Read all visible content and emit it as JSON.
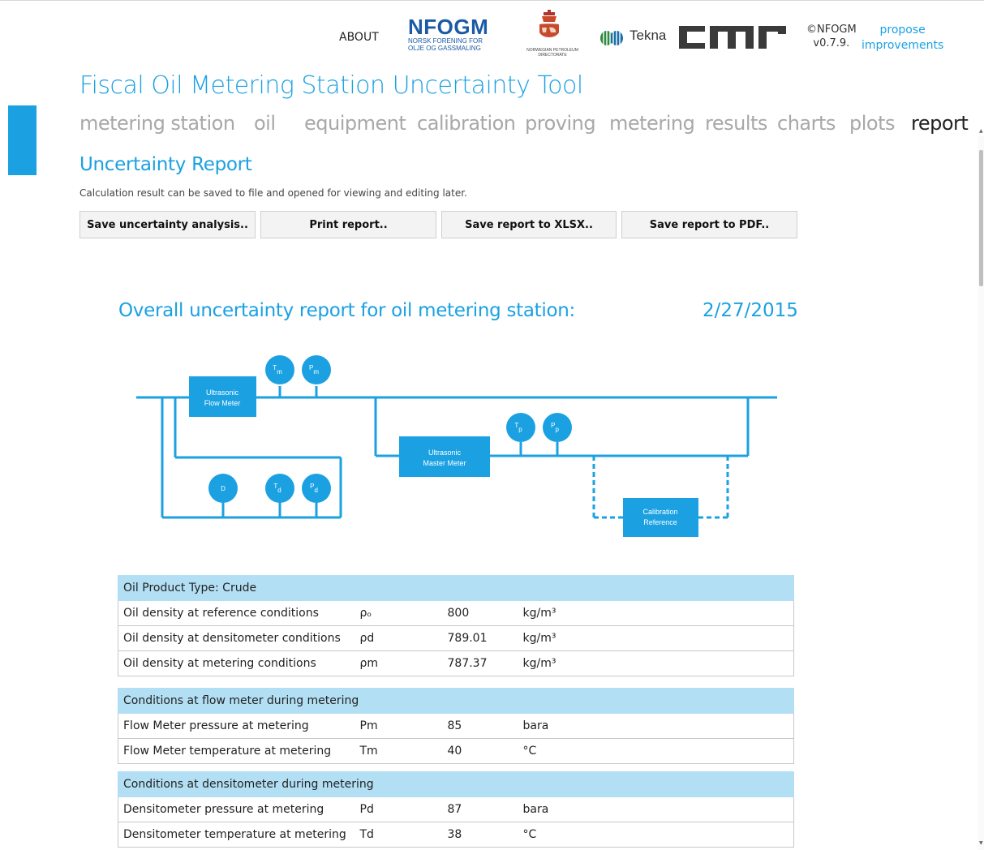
{
  "header": {
    "about_label": "ABOUT",
    "nfogm_logo": {
      "name": "NFOGM",
      "tagline_line1": "NORSK FORENING FOR",
      "tagline_line2": "OLJE OG GASSMALING"
    },
    "npd_logo": {
      "line1": "NORWEGIAN PETROLEUM",
      "line2": "DIRECTORATE"
    },
    "tekna_logo": "Tekna",
    "cmr_logo": "cmr",
    "copyright": "©NFOGM",
    "version": "v0.7.9.",
    "propose_line1": "propose",
    "propose_line2": "improvements"
  },
  "app_title": "Fiscal Oil Metering Station Uncertainty Tool",
  "nav": {
    "items": [
      "metering station",
      "oil",
      "equipment",
      "calibration",
      "proving",
      "metering",
      "results",
      "charts",
      "plots",
      "report"
    ],
    "active": "report"
  },
  "section": {
    "title": "Uncertainty Report",
    "description": "Calculation result can be saved to file and opened for viewing and editing later."
  },
  "buttons": {
    "save_analysis": "Save uncertainty analysis..",
    "print": "Print report..",
    "save_xlsx": "Save report to XLSX..",
    "save_pdf": "Save report to PDF.."
  },
  "report": {
    "heading": "Overall uncertainty report for oil metering station:",
    "date": "2/27/2015"
  },
  "diagram": {
    "flow_meter_line1": "Ultrasonic",
    "flow_meter_line2": "Flow Meter",
    "master_meter_line1": "Ultrasonic",
    "master_meter_line2": "Master Meter",
    "calibration_line1": "Calibration",
    "calibration_line2": "Reference",
    "sensors": {
      "tm": {
        "base": "T",
        "sub": "m"
      },
      "pm": {
        "base": "P",
        "sub": "m"
      },
      "tp": {
        "base": "T",
        "sub": "p"
      },
      "pp": {
        "base": "P",
        "sub": "p"
      },
      "d": {
        "base": "D",
        "sub": ""
      },
      "td": {
        "base": "T",
        "sub": "d"
      },
      "pd": {
        "base": "P",
        "sub": "d"
      }
    },
    "colors": {
      "pipe": "#1ba1e2",
      "box": "#1ba1e2",
      "box_text": "#ffffff"
    }
  },
  "tables": [
    {
      "header": "Oil Product Type: Crude",
      "rows": [
        {
          "label": "Oil density at reference conditions",
          "symbol": "ρₒ",
          "value": "800",
          "unit": "kg/m³"
        },
        {
          "label": "Oil density at densitometer conditions",
          "symbol": "ρd",
          "value": "789.01",
          "unit": "kg/m³"
        },
        {
          "label": "Oil density at metering conditions",
          "symbol": "ρm",
          "value": "787.37",
          "unit": "kg/m³"
        }
      ]
    },
    {
      "header": "Conditions at flow meter during metering",
      "rows": [
        {
          "label": "Flow Meter pressure at metering",
          "symbol": "Pm",
          "value": "85",
          "unit": "bara"
        },
        {
          "label": "Flow Meter temperature at metering",
          "symbol": "Tm",
          "value": "40",
          "unit": "°C"
        }
      ]
    },
    {
      "header": "Conditions at densitometer during metering",
      "rows": [
        {
          "label": "Densitometer pressure at metering",
          "symbol": "Pd",
          "value": "87",
          "unit": "bara"
        },
        {
          "label": "Densitometer temperature at metering",
          "symbol": "Td",
          "value": "38",
          "unit": "°C"
        }
      ]
    }
  ],
  "colors": {
    "accent": "#1ba1e2",
    "table_header_bg": "#b3dff4",
    "nav_inactive": "#a8a8a8",
    "nav_active": "#222222"
  }
}
